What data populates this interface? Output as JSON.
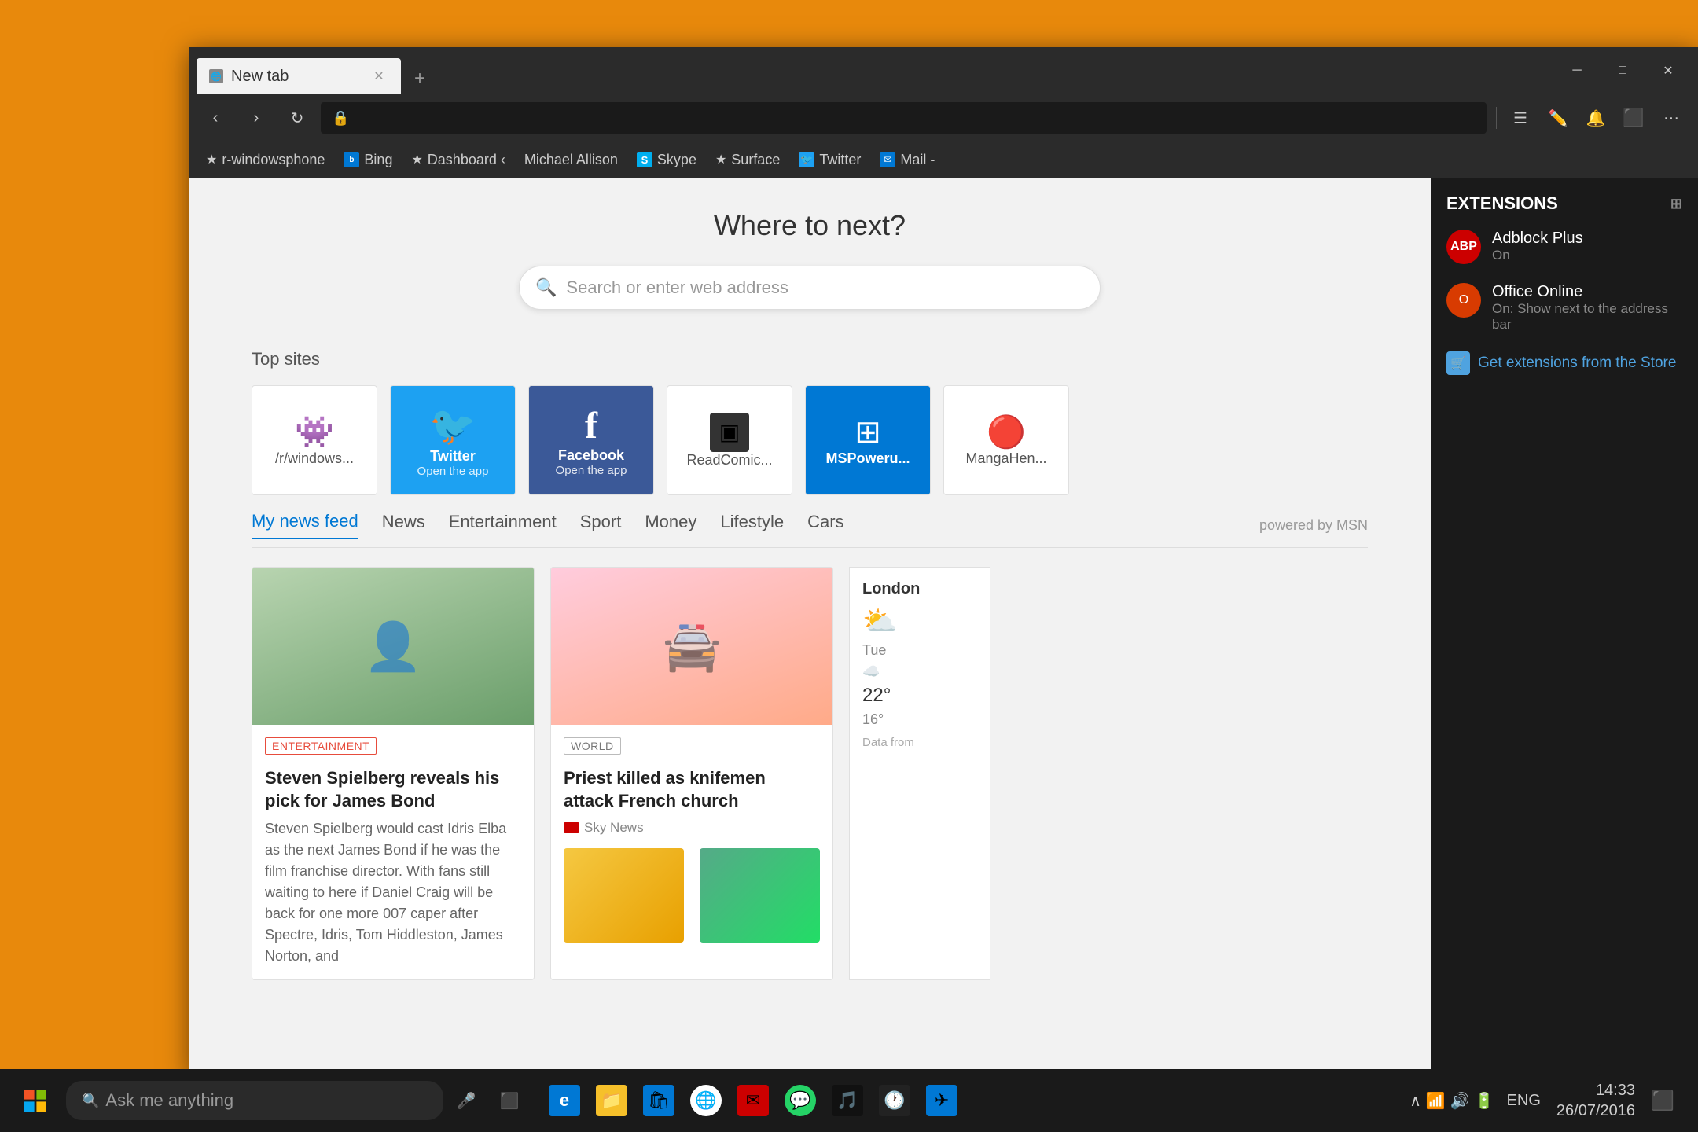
{
  "window": {
    "title": "New tab",
    "close_label": "✕",
    "minimize_label": "─",
    "maximize_label": "□"
  },
  "tab": {
    "label": "New tab",
    "new_tab_plus": "+"
  },
  "navbar": {
    "back": "‹",
    "forward": "›",
    "refresh": "↻",
    "address_placeholder": ""
  },
  "bookmarks": [
    {
      "label": "r-windowsphone",
      "icon": "★",
      "type": "star"
    },
    {
      "label": "Bing",
      "icon": "B",
      "type": "bing"
    },
    {
      "label": "Dashboard ‹",
      "icon": "★",
      "type": "star"
    },
    {
      "label": "Michael Allison",
      "icon": "★",
      "type": "star"
    },
    {
      "label": "Skype",
      "icon": "S",
      "type": "skype"
    },
    {
      "label": "Surface",
      "icon": "★",
      "type": "star"
    },
    {
      "label": "Twitter",
      "icon": "t",
      "type": "twitter"
    },
    {
      "label": "Mail -",
      "icon": "✉",
      "type": "mail"
    }
  ],
  "new_tab_page": {
    "heading": "Where to next?",
    "search_placeholder": "Search or enter web address",
    "top_sites_label": "Top sites",
    "top_sites": [
      {
        "name": "/r/windows...",
        "icon": "👾",
        "type": "reddit"
      },
      {
        "name": "Twitter",
        "sub": "Open the app",
        "type": "twitter"
      },
      {
        "name": "Facebook",
        "sub": "Open the app",
        "type": "facebook"
      },
      {
        "name": "ReadComic...",
        "icon": "📖",
        "type": "readcomic"
      },
      {
        "name": "MSPoweru...",
        "icon": "⊞",
        "type": "mspower"
      },
      {
        "name": "MangaHen...",
        "icon": "📕",
        "type": "manga"
      }
    ],
    "news": {
      "tabs": [
        "My news feed",
        "News",
        "Entertainment",
        "Sport",
        "Money",
        "Lifestyle",
        "Cars"
      ],
      "active_tab": "My news feed",
      "powered_by": "powered by MSN",
      "articles": [
        {
          "category": "Entertainment",
          "title": "Steven Spielberg reveals his pick for James Bond",
          "excerpt": "Steven Spielberg would cast Idris Elba as the next James Bond if he was the film franchise director. With fans still waiting to here if Daniel Craig will be back for one more 007 caper after Spectre, Idris, Tom Hiddleston, James Norton, and",
          "type": "spielberg"
        },
        {
          "category": "World",
          "title": "Priest killed as knifemen attack French church",
          "source": "Sky News",
          "type": "world"
        }
      ]
    }
  },
  "extensions": {
    "title": "EXTENSIONS",
    "items": [
      {
        "name": "Adblock Plus",
        "status": "On",
        "logo_text": "ABP",
        "type": "abp"
      },
      {
        "name": "Office Online",
        "status": "On: Show next to the address bar",
        "logo_text": "O",
        "type": "office"
      }
    ],
    "store_link": "Get extensions from the Store"
  },
  "weather": {
    "city": "London",
    "day": "Tue",
    "high": "22°",
    "low": "16°",
    "data_from": "Data from"
  },
  "taskbar": {
    "search_placeholder": "Ask me anything",
    "time": "14:33",
    "date": "26/07/2016",
    "lang": "ENG"
  }
}
